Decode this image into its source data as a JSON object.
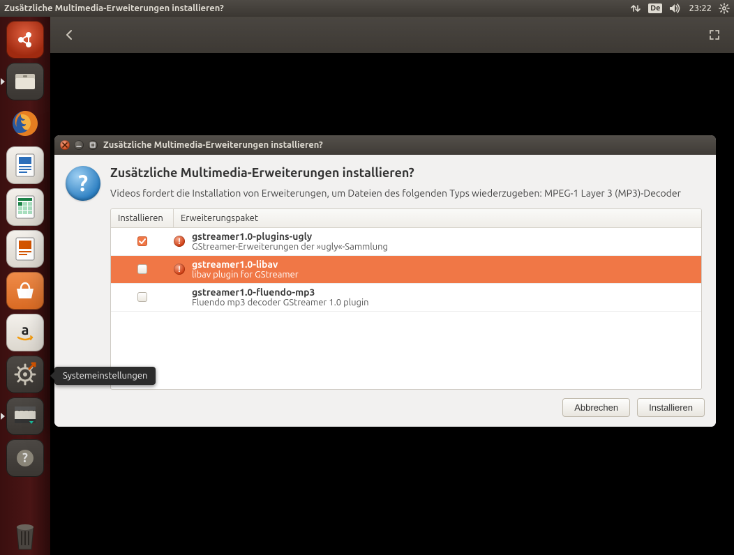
{
  "panel": {
    "title": "Zusätzliche Multimedia-Erweiterungen installieren?",
    "keyboard_indicator": "De",
    "time": "23:22"
  },
  "launcher": {
    "tooltip": "Systemeinstellungen"
  },
  "dialog": {
    "title": "Zusätzliche Multimedia-Erweiterungen installieren?",
    "heading": "Zusätzliche Multimedia-Erweiterungen installieren?",
    "description": "Videos fordert die Installation von Erweiterungen, um Dateien des folgenden Typs wiederzugeben: MPEG-1 Layer 3 (MP3)-Decoder",
    "columns": {
      "install": "Installieren",
      "package": "Erweiterungspaket"
    },
    "packages": [
      {
        "checked": true,
        "warn": true,
        "selected": false,
        "name": "gstreamer1.0-plugins-ugly",
        "desc": "GStreamer-Erweiterungen der »ugly«-Sammlung"
      },
      {
        "checked": false,
        "warn": true,
        "selected": true,
        "name": "gstreamer1.0-libav",
        "desc": "libav plugin for GStreamer"
      },
      {
        "checked": false,
        "warn": false,
        "selected": false,
        "name": "gstreamer1.0-fluendo-mp3",
        "desc": "Fluendo mp3 decoder GStreamer 1.0 plugin"
      }
    ],
    "buttons": {
      "cancel": "Abbrechen",
      "install": "Installieren"
    }
  }
}
